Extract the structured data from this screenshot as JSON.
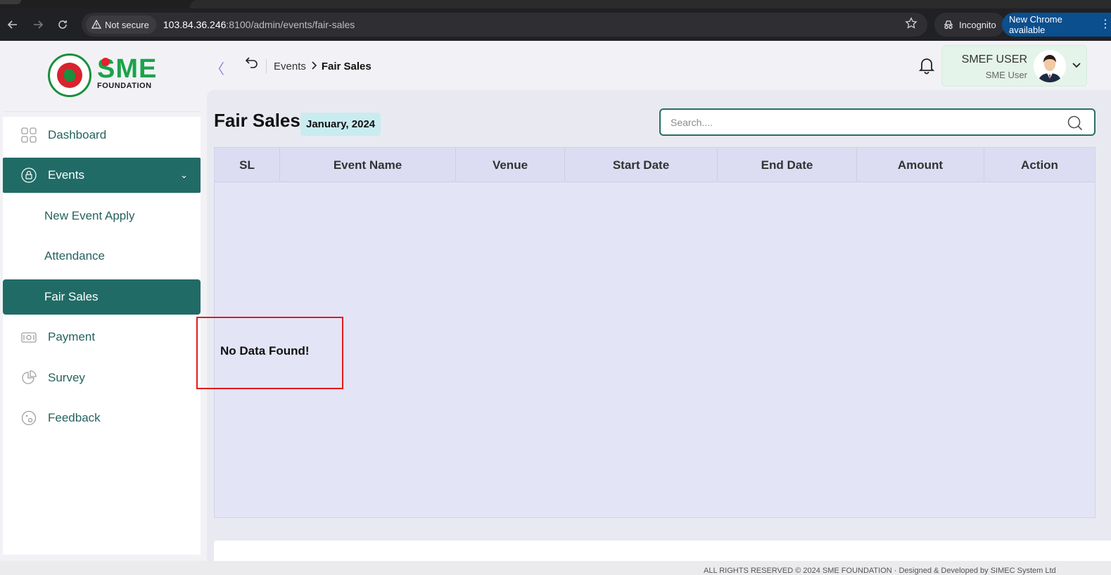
{
  "browser": {
    "security_label": "Not secure",
    "url_host": "103.84.36.246",
    "url_rest": ":8100/admin/events/fair-sales",
    "incognito_label": "Incognito",
    "update_label": "New Chrome available"
  },
  "logo": {
    "brand": "SME",
    "subtitle": "FOUNDATION"
  },
  "sidebar": {
    "items": [
      {
        "label": "Dashboard",
        "icon": "grid-icon"
      },
      {
        "label": "Events",
        "icon": "lock-icon"
      },
      {
        "label": "Payment",
        "icon": "cash-icon"
      },
      {
        "label": "Survey",
        "icon": "pie-chart-icon"
      },
      {
        "label": "Feedback",
        "icon": "feedback-icon"
      }
    ],
    "sub_items": [
      {
        "label": "New Event Apply"
      },
      {
        "label": "Attendance"
      },
      {
        "label": "Fair Sales"
      }
    ]
  },
  "header": {
    "breadcrumb_parent": "Events",
    "breadcrumb_current": "Fair Sales",
    "user_name": "SMEF USER",
    "user_role": "SME User"
  },
  "main": {
    "title": "Fair Sales",
    "month_badge": "January, 2024",
    "search_placeholder": "Search....",
    "columns": [
      "SL",
      "Event Name",
      "Venue",
      "Start Date",
      "End Date",
      "Amount",
      "Action"
    ],
    "rows": [],
    "empty_message": "No Data Found!"
  },
  "footer": {
    "text": "ALL RIGHTS RESERVED © 2024 SME FOUNDATION · Designed & Developed by SIMEC System Ltd"
  },
  "colors": {
    "primary": "#216b66",
    "accent": "#1aa34a",
    "table_bg": "#e4e4f7",
    "highlight": "#e31b1b"
  }
}
